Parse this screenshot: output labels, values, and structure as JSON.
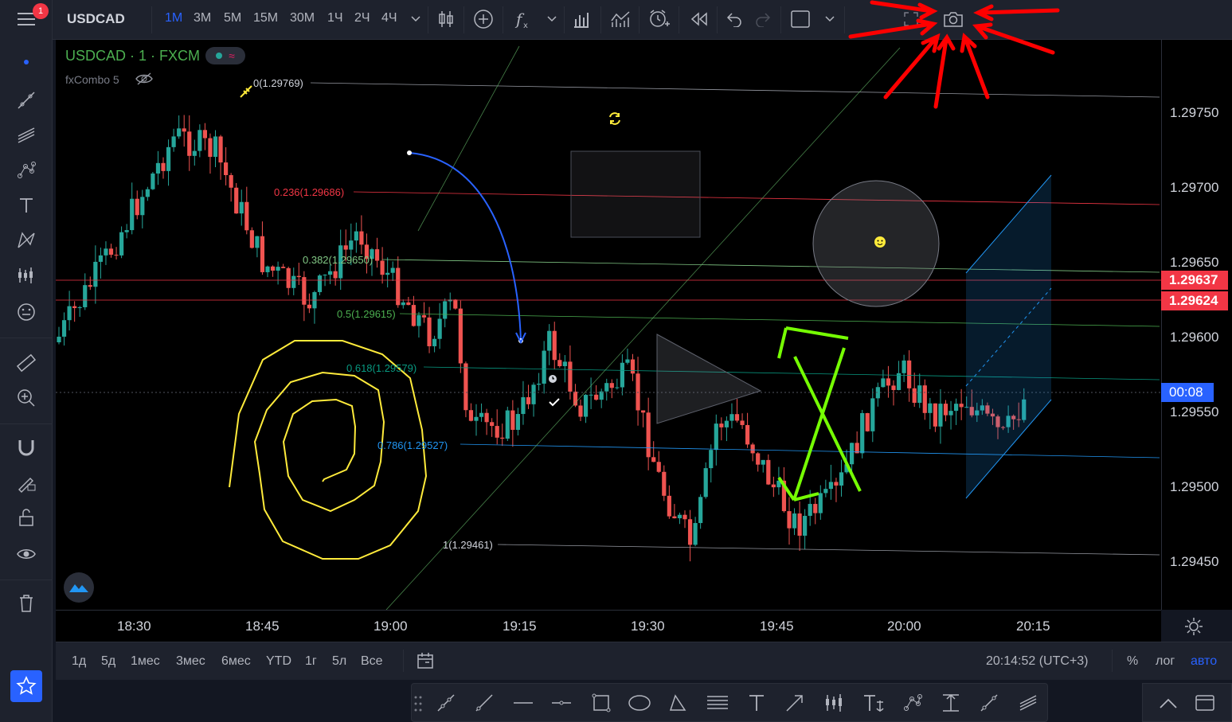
{
  "toolbar": {
    "symbol": "USDCAD",
    "timeframes": [
      "1М",
      "3М",
      "5М",
      "15М",
      "30М",
      "1Ч",
      "2Ч",
      "4Ч"
    ],
    "active_timeframe": "1М",
    "notification_count": "1"
  },
  "legend": {
    "symbol_line": "USDCAD · 1 · FXCM",
    "indicator": "fxCombo 5"
  },
  "fib_levels": [
    {
      "label": "0(1.29769)",
      "color": "#b2b5be"
    },
    {
      "label": "0.236(1.29686)",
      "color": "#f23645"
    },
    {
      "label": "0.382(1.29650)",
      "color": "#81c784"
    },
    {
      "label": "0.5(1.29615)",
      "color": "#4caf50"
    },
    {
      "label": "0.618(1.29579)",
      "color": "#089981"
    },
    {
      "label": "0.786(1.29527)",
      "color": "#2196f3"
    },
    {
      "label": "1(1.29461)",
      "color": "#b2b5be"
    }
  ],
  "price_axis": {
    "labels": [
      "1.29750",
      "1.29700",
      "1.29650",
      "1.29600",
      "1.29550",
      "1.29500",
      "1.29450"
    ],
    "tags": [
      {
        "value": "1.29637",
        "color": "#f23645"
      },
      {
        "value": "1.29624",
        "color": "#f23645"
      }
    ],
    "countdown": "00:08",
    "countdown_color": "#2962ff"
  },
  "time_axis": {
    "labels": [
      "18:30",
      "18:45",
      "19:00",
      "19:15",
      "19:30",
      "19:45",
      "20:00",
      "20:15"
    ]
  },
  "bottom": {
    "ranges": [
      "1д",
      "5д",
      "1мес",
      "3мес",
      "6мес",
      "YTD",
      "1г",
      "5л",
      "Все"
    ],
    "clock": "20:14:52 (UTC+3)",
    "percent": "%",
    "log": "лог",
    "auto": "авто"
  },
  "colors": {
    "up": "#26a69a",
    "down": "#ef5350",
    "annotation_red": "#ff0000",
    "yellow": "#ffeb3b",
    "green": "#76ff03"
  }
}
